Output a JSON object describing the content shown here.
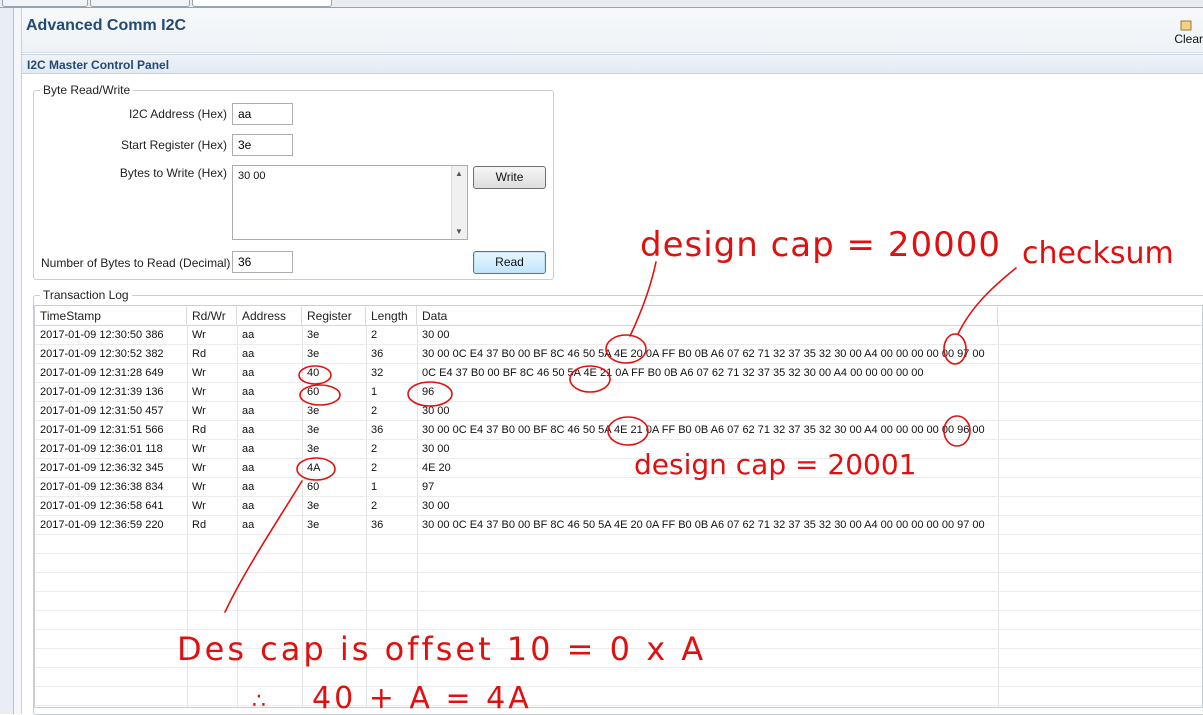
{
  "app": {
    "title": "Advanced Comm I2C",
    "clear_label": "Clear"
  },
  "panel": {
    "title": "I2C Master Control Panel"
  },
  "byte_rw": {
    "legend": "Byte Read/Write",
    "i2c_address_label": "I2C Address (Hex)",
    "i2c_address_value": "aa",
    "start_register_label": "Start Register (Hex)",
    "start_register_value": "3e",
    "bytes_to_write_label": "Bytes to Write (Hex)",
    "bytes_to_write_value": "30 00",
    "write_label": "Write",
    "num_bytes_read_label": "Number of Bytes to Read (Decimal)",
    "num_bytes_read_value": "36",
    "read_label": "Read"
  },
  "log": {
    "legend": "Transaction Log",
    "columns": [
      "TimeStamp",
      "Rd/Wr",
      "Address",
      "Register",
      "Length",
      "Data"
    ],
    "rows": [
      [
        "2017-01-09 12:30:50 386",
        "Wr",
        "aa",
        "3e",
        "2",
        "30 00"
      ],
      [
        "2017-01-09 12:30:52 382",
        "Rd",
        "aa",
        "3e",
        "36",
        "30 00 0C E4 37 B0 00 BF 8C 46 50 5A 4E 20 0A FF B0 0B A6 07 62 71 32 37 35 32 30 00 A4 00 00 00 00 00 97 00"
      ],
      [
        "2017-01-09 12:31:28 649",
        "Wr",
        "aa",
        "40",
        "32",
        "0C E4 37 B0 00 BF 8C 46 50 5A 4E 21 0A FF B0 0B A6 07 62 71 32 37 35 32 30 00 A4 00 00 00 00 00"
      ],
      [
        "2017-01-09 12:31:39 136",
        "Wr",
        "aa",
        "60",
        "1",
        "96"
      ],
      [
        "2017-01-09 12:31:50 457",
        "Wr",
        "aa",
        "3e",
        "2",
        "30 00"
      ],
      [
        "2017-01-09 12:31:51 566",
        "Rd",
        "aa",
        "3e",
        "36",
        "30 00 0C E4 37 B0 00 BF 8C 46 50 5A 4E 21 0A FF B0 0B A6 07 62 71 32 37 35 32 30 00 A4 00 00 00 00 00 96 00"
      ],
      [
        "2017-01-09 12:36:01 118",
        "Wr",
        "aa",
        "3e",
        "2",
        "30 00"
      ],
      [
        "2017-01-09 12:36:32 345",
        "Wr",
        "aa",
        "4A",
        "2",
        "4E 20"
      ],
      [
        "2017-01-09 12:36:38 834",
        "Wr",
        "aa",
        "60",
        "1",
        "97"
      ],
      [
        "2017-01-09 12:36:58 641",
        "Wr",
        "aa",
        "3e",
        "2",
        "30 00"
      ],
      [
        "2017-01-09 12:36:59 220",
        "Rd",
        "aa",
        "3e",
        "36",
        "30 00 0C E4 37 B0 00 BF 8C 46 50 5A 4E 20 0A FF B0 0B A6 07 62 71 32 37 35 32 30 00 A4 00 00 00 00 00 97 00"
      ]
    ]
  },
  "annotations": {
    "design_cap_1": "design cap = 20000",
    "checksum": "checksum",
    "design_cap_2": "design cap = 20001",
    "offset_note": "Des cap is offset 10 = 0 x A",
    "sum_note": "40 + A = 4A",
    "therefore": "∴",
    "color": "#e01010"
  }
}
